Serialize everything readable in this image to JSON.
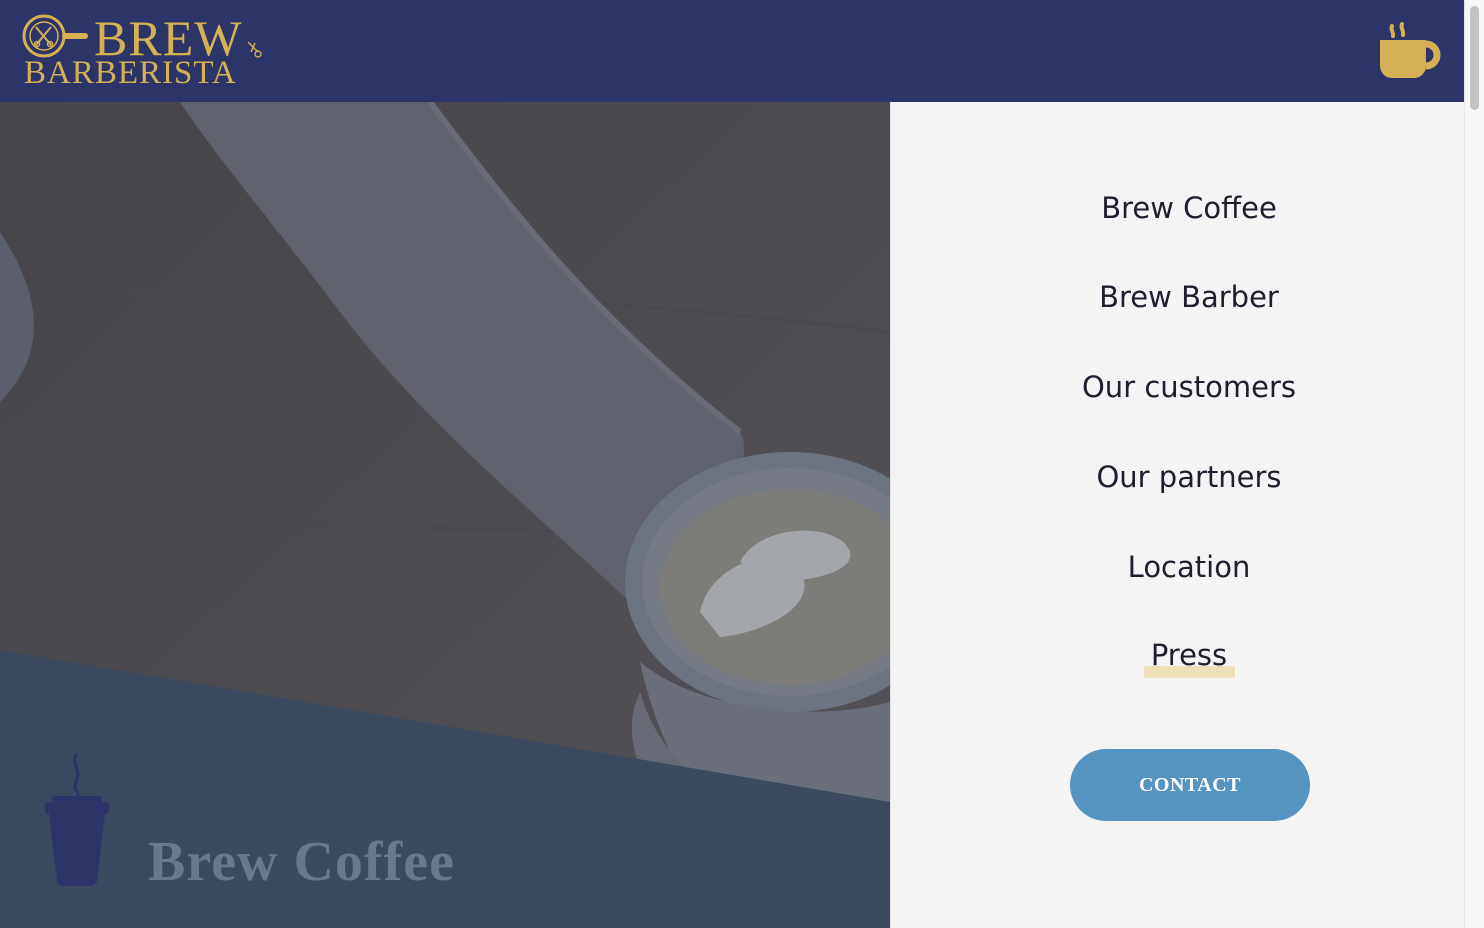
{
  "brand": {
    "name_top": "BREW",
    "name_bottom": "BARBERISTA",
    "color_gold": "#d4b254",
    "color_navy": "#2d3468"
  },
  "header": {
    "menu_toggle_icon": "coffee-cup-icon"
  },
  "hero": {
    "title": "Brew Coffee",
    "icon": "takeaway-coffee-icon"
  },
  "menu": {
    "items": [
      {
        "label": "Brew Coffee"
      },
      {
        "label": "Brew Barber"
      },
      {
        "label": "Our customers"
      },
      {
        "label": "Our partners"
      },
      {
        "label": "Location"
      },
      {
        "label": "Press"
      }
    ],
    "contact_label": "CONTACT",
    "contact_color": "#5593c0",
    "highlight_color": "#ecdfba"
  }
}
